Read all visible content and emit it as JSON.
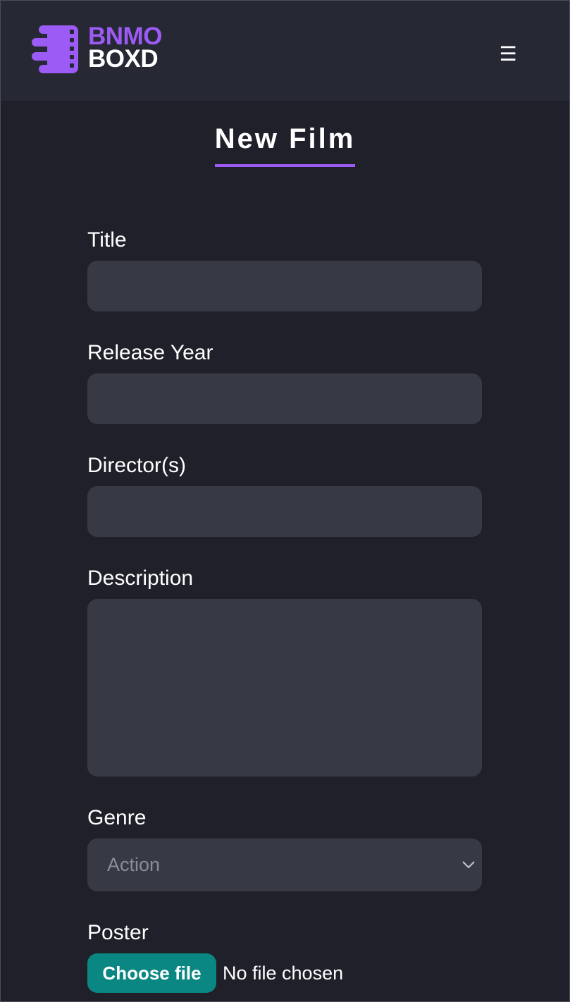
{
  "brand": {
    "line1": "BNMO",
    "line2": "BOXD"
  },
  "nav": {
    "menu_icon": "hamburger-menu-icon"
  },
  "page": {
    "title": "New Film"
  },
  "form": {
    "title_label": "Title",
    "title_value": "",
    "release_year_label": "Release Year",
    "release_year_value": "",
    "directors_label": "Director(s)",
    "directors_value": "",
    "description_label": "Description",
    "description_value": "",
    "genre_label": "Genre",
    "genre_selected": "Action",
    "poster_label": "Poster",
    "poster_button": "Choose file",
    "poster_status": "No file chosen"
  },
  "colors": {
    "background": "#1f2029",
    "navbar": "#262833",
    "accent_purple": "#9c5bf5",
    "input_bg": "#373a45",
    "file_button": "#0b8783"
  }
}
